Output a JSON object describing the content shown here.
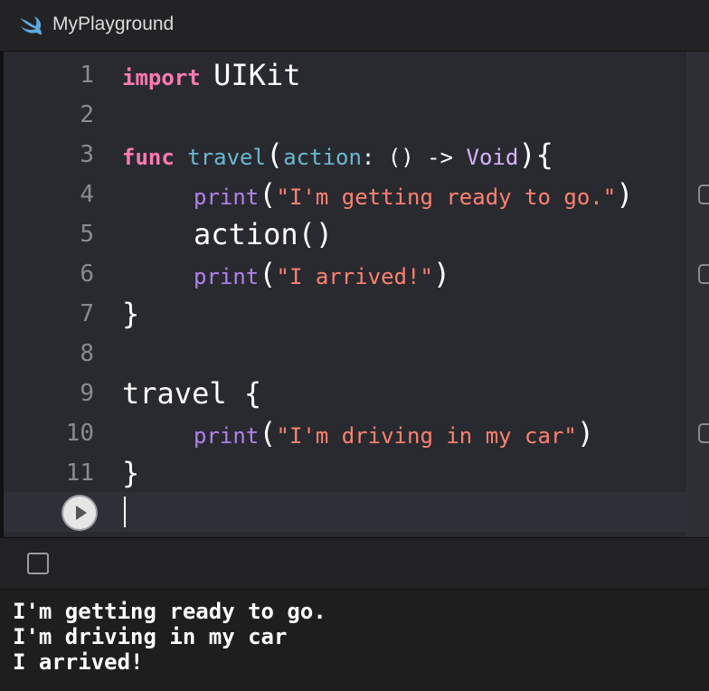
{
  "window": {
    "title": "MyPlayground",
    "icon": "swift-icon"
  },
  "editor": {
    "lines": [
      {
        "num": "1",
        "tokens": [
          "import",
          "UIKit"
        ]
      },
      {
        "num": "2"
      },
      {
        "num": "3",
        "tokens": [
          "func",
          "travel",
          "(",
          "action",
          ":",
          "() ->",
          "Void",
          "){"
        ]
      },
      {
        "num": "4",
        "tokens": [
          "print",
          "(",
          "\"I'm getting ready to go.\"",
          ")"
        ]
      },
      {
        "num": "5",
        "tokens": [
          "action()"
        ]
      },
      {
        "num": "6",
        "tokens": [
          "print",
          "(",
          "\"I arrived!\"",
          ")"
        ]
      },
      {
        "num": "7",
        "tokens": [
          "}"
        ]
      },
      {
        "num": "8"
      },
      {
        "num": "9",
        "tokens": [
          "travel {"
        ]
      },
      {
        "num": "10",
        "tokens": [
          "print",
          "(",
          "\"I'm driving in my car\"",
          ")"
        ]
      },
      {
        "num": "11",
        "tokens": [
          "}"
        ]
      }
    ]
  },
  "run_button": {
    "icon": "play-icon"
  },
  "console": {
    "toggle_icon": "checkbox-icon",
    "output": [
      "I'm getting ready to go.",
      "I'm driving in my car",
      "I arrived!"
    ]
  },
  "colors": {
    "keyword": "#ff7ab2",
    "function": "#6bb8d1",
    "type": "#d8b4ff",
    "print": "#b281eb",
    "string": "#ff8170",
    "editor_bg": "#292a30"
  }
}
